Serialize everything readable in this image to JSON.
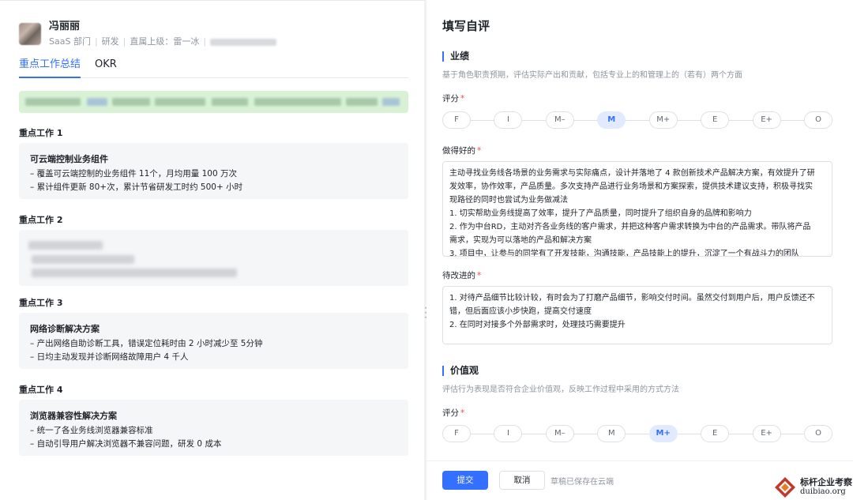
{
  "profile": {
    "name": "冯丽丽",
    "dept": "SaaS 部门",
    "role": "研发",
    "manager_label": "直属上级：雷一冰"
  },
  "tabs": [
    {
      "label": "重点工作总结",
      "active": true
    },
    {
      "label": "OKR",
      "active": false
    }
  ],
  "works": [
    {
      "heading": "重点工作 1",
      "title": "可云端控制业务组件",
      "lines": [
        "– 覆盖可云端控制的业务组件 11个，月均用量 100 万次",
        "– 累计组件更新 80+次，累计节省研发工时约 500+ 小时"
      ]
    },
    {
      "heading": "重点工作 2",
      "title": "",
      "lines": []
    },
    {
      "heading": "重点工作 3",
      "title": "网络诊断解决方案",
      "lines": [
        "– 产出网络自助诊断工具，错误定位耗时由 2 小时减少至 5分钟",
        "– 日均主动发现并诊断网络故障用户 4 千人"
      ]
    },
    {
      "heading": "重点工作 4",
      "title": "浏览器兼容性解决方案",
      "lines": [
        "– 统一了各业务线浏览器兼容标准",
        "– 自动引导用户解决浏览器不兼容问题，研发 0 成本"
      ]
    }
  ],
  "form": {
    "title": "填写自评",
    "performance": {
      "heading": "业绩",
      "desc": "基于角色职责预期，评估实际产出和贡献，包括专业上的和管理上的（若有）两个方面",
      "rating_label": "评分",
      "selected": "M"
    },
    "good_label": "做得好的",
    "good_text": [
      "主动寻找业务线各场景的业务需求与实际痛点，设计并落地了 4 款创新技术产品解决方案，有效提升了研",
      "发效率，协作效率，产品质量。多次支持产品进行业务场景和方案探索，提供技术建议支持，积极寻找实",
      "现路径的同时也尝试为业务做减法",
      "1. 切实帮助业务线提高了效率，提升了产品质量，同时提升了组织自身的品牌和影响力",
      "2. 作为中台RD，主动对齐各业务线的客户需求，并把这种客户需求转换为中台的产品需求。带队将产品",
      "需求，实现为可以落地的产品和解决方案",
      "3. 项目中，让参与的同学有了开发技能，沟通技能，产品技能上的提升，沉淀了一个有战斗力的团队"
    ],
    "improve_label": "待改进的",
    "improve_text": [
      "1. 对待产品细节比较计较，有时会为了打磨产品细节，影响交付时间。虽然交付到用户后，用户反馈还不",
      "错，但后面应该小步快跑，提高交付速度",
      "2. 在同时对接多个外部需求时，处理技巧需要提升"
    ],
    "values": {
      "heading": "价值观",
      "desc": "评估行为表现是否符合企业价值观，反映工作过程中采用的方式方法",
      "rating_label": "评分",
      "selected": "M+"
    },
    "scale": [
      "F",
      "I",
      "M–",
      "M",
      "M+",
      "E",
      "E+",
      "O"
    ]
  },
  "footer": {
    "submit_label": "提交",
    "cancel_label": "取消",
    "draft_status": "草稿已保存在云端"
  },
  "watermark": {
    "line1": "标杆企业考察",
    "line2": "duibiao.org"
  },
  "colors": {
    "accent": "#3370ff",
    "selected_bg": "#e1eaff",
    "required": "#f54a45",
    "banner": "#d9f2d6"
  }
}
